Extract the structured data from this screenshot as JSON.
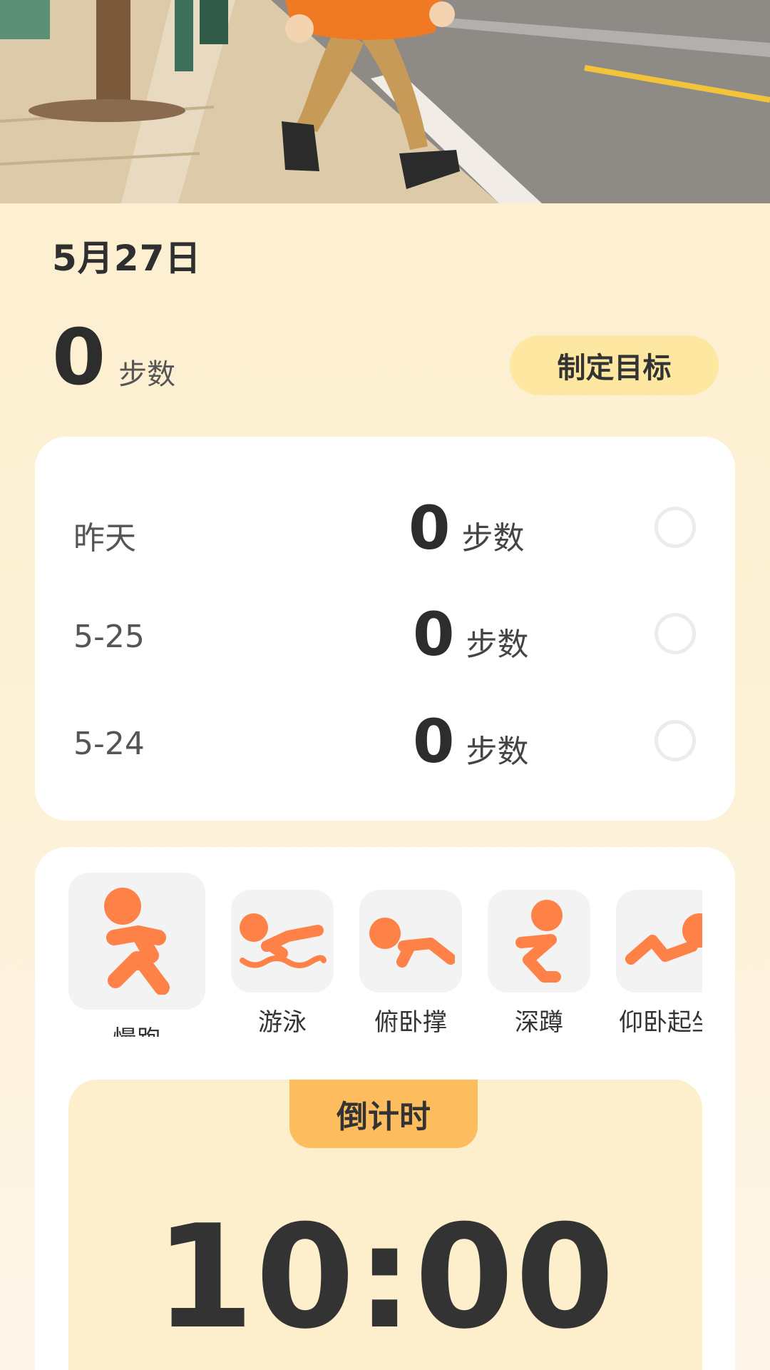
{
  "hero": {
    "icon": "walking-person-illustration"
  },
  "header": {
    "date": "5月27日",
    "today_steps": "0",
    "steps_unit": "步数",
    "goal_button": "制定目标"
  },
  "history": [
    {
      "label": "昨天",
      "steps": "0",
      "unit": "步数"
    },
    {
      "label": "5-25",
      "steps": "0",
      "unit": "步数"
    },
    {
      "label": "5-24",
      "steps": "0",
      "unit": "步数"
    }
  ],
  "exercises": [
    {
      "name": "慢跑",
      "icon": "jogging-icon",
      "selected": true
    },
    {
      "name": "游泳",
      "icon": "swimming-icon",
      "selected": false
    },
    {
      "name": "俯卧撑",
      "icon": "pushup-icon",
      "selected": false
    },
    {
      "name": "深蹲",
      "icon": "squat-icon",
      "selected": false
    },
    {
      "name": "仰卧起坐",
      "icon": "situp-icon",
      "selected": false
    }
  ],
  "timer": {
    "tab_label": "倒计时",
    "value": "10:00"
  },
  "colors": {
    "accent": "#fe8147",
    "goal_button": "#fde7a1",
    "timer_tab": "#fdbd5f",
    "timer_panel": "#fdefcc"
  }
}
